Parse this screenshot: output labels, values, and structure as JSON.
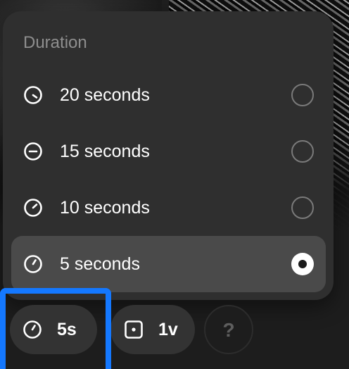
{
  "popover": {
    "title": "Duration",
    "options": [
      {
        "label": "20 seconds",
        "icon": "timer-20-icon",
        "selected": false
      },
      {
        "label": "15 seconds",
        "icon": "timer-15-icon",
        "selected": false
      },
      {
        "label": "10 seconds",
        "icon": "timer-10-icon",
        "selected": false
      },
      {
        "label": "5 seconds",
        "icon": "timer-5-icon",
        "selected": true
      }
    ]
  },
  "toolbar": {
    "duration_label": "5s",
    "duration_icon": "timer-icon",
    "variations_label": "1v",
    "variations_icon": "square-dot-icon",
    "help_label": "?",
    "help_icon": "question-icon"
  },
  "colors": {
    "highlight": "#1478ff",
    "popover_bg": "#2f2f2f",
    "selected_row_bg": "#4a4a4a",
    "title_text": "#8e8e8e"
  }
}
